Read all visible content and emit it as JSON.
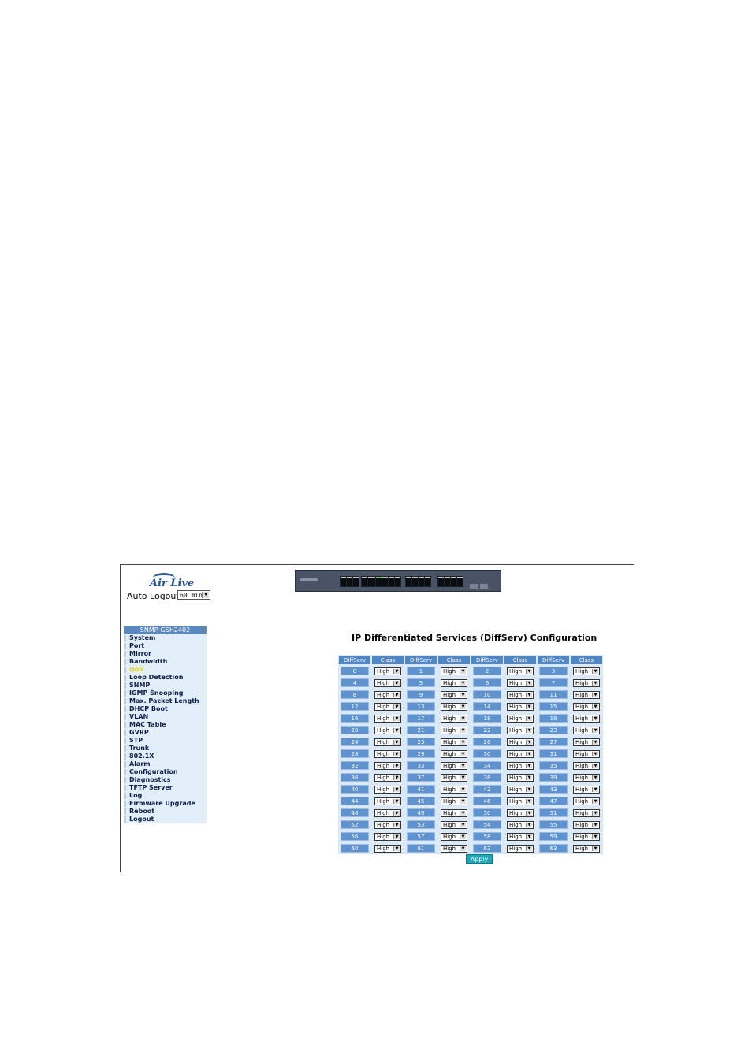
{
  "header": {
    "logo_text": "Air Live",
    "auto_logout_label": "Auto Logout",
    "auto_logout_value": "60 min"
  },
  "sidebar": {
    "title": "SNMP-GSH2402",
    "items": [
      {
        "label": "System"
      },
      {
        "label": "Port"
      },
      {
        "label": "Mirror"
      },
      {
        "label": "Bandwidth"
      },
      {
        "label": "QoS",
        "active": true
      },
      {
        "label": "Loop Detection"
      },
      {
        "label": "SNMP"
      },
      {
        "label": "IGMP Snooping"
      },
      {
        "label": "Max. Packet Length"
      },
      {
        "label": "DHCP Boot"
      },
      {
        "label": "VLAN"
      },
      {
        "label": "MAC Table"
      },
      {
        "label": "GVRP"
      },
      {
        "label": "STP"
      },
      {
        "label": "Trunk"
      },
      {
        "label": "802.1X"
      },
      {
        "label": "Alarm"
      },
      {
        "label": "Configuration"
      },
      {
        "label": "Diagnostics"
      },
      {
        "label": "TFTP Server"
      },
      {
        "label": "Log"
      },
      {
        "label": "Firmware Upgrade"
      },
      {
        "label": "Reboot"
      },
      {
        "label": "Logout"
      }
    ]
  },
  "main": {
    "title": "IP Differentiated Services (DiffServ) Configuration",
    "col_diffserv": "DiffServ",
    "col_class": "Class",
    "class_value": "High",
    "apply_label": "Apply",
    "rows": [
      [
        "0",
        "1",
        "2",
        "3"
      ],
      [
        "4",
        "5",
        "6",
        "7"
      ],
      [
        "8",
        "9",
        "10",
        "11"
      ],
      [
        "12",
        "13",
        "14",
        "15"
      ],
      [
        "16",
        "17",
        "18",
        "19"
      ],
      [
        "20",
        "21",
        "22",
        "23"
      ],
      [
        "24",
        "25",
        "26",
        "27"
      ],
      [
        "28",
        "29",
        "30",
        "31"
      ],
      [
        "32",
        "33",
        "34",
        "35"
      ],
      [
        "36",
        "37",
        "38",
        "39"
      ],
      [
        "40",
        "41",
        "42",
        "43"
      ],
      [
        "44",
        "45",
        "46",
        "47"
      ],
      [
        "48",
        "49",
        "50",
        "51"
      ],
      [
        "52",
        "53",
        "54",
        "55"
      ],
      [
        "56",
        "57",
        "58",
        "59"
      ],
      [
        "60",
        "61",
        "62",
        "63"
      ]
    ]
  }
}
